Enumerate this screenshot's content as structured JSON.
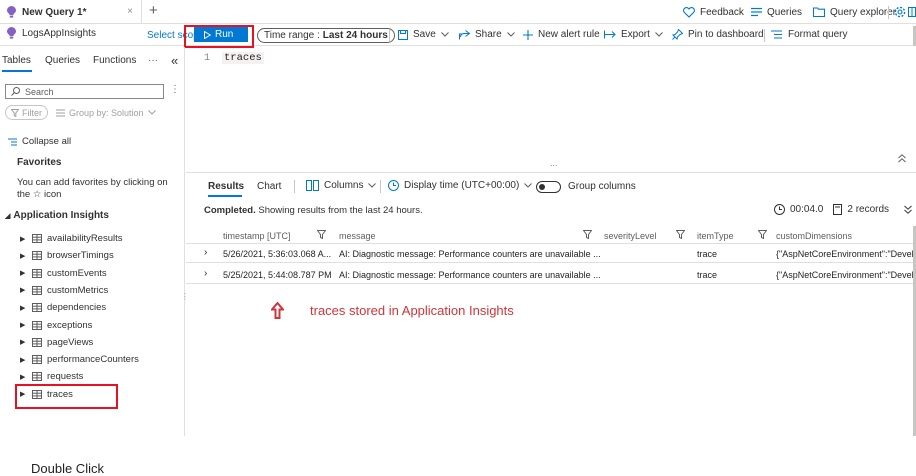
{
  "tabbar": {
    "tab_title": "New Query 1*",
    "close_glyph": "×",
    "new_tab_glyph": "+",
    "feedback": "Feedback",
    "queries": "Queries",
    "query_explorer": "Query explorer",
    "tab_icon": "lightbulb-icon"
  },
  "toolbar": {
    "scope_name": "LogsAppInsights",
    "select_scope": "Select scope",
    "run_label": "Run",
    "time_range_label": "Time range :",
    "time_range_value": "Last 24 hours",
    "save": "Save",
    "share": "Share",
    "new_alert": "New alert rule",
    "export": "Export",
    "pin": "Pin to dashboard",
    "format": "Format query"
  },
  "panel": {
    "tabs": [
      "Tables",
      "Queries",
      "Functions"
    ],
    "more": "···",
    "collapse_glyph": "«",
    "search_placeholder": "Search",
    "filter": "Filter",
    "group_by": "Group by: Solution",
    "collapse_all": "Collapse all",
    "favorites_title": "Favorites",
    "favorites_desc": "You can add favorites by clicking on the ☆ icon",
    "section": "Application Insights",
    "tables": [
      "availabilityResults",
      "browserTimings",
      "customEvents",
      "customMetrics",
      "dependencies",
      "exceptions",
      "pageViews",
      "performanceCounters",
      "requests",
      "traces"
    ],
    "double_click_note": "Double Click"
  },
  "editor": {
    "line_number": "1",
    "code": "traces",
    "splitter_dots": "...",
    "expand_glyph": "«"
  },
  "results": {
    "tabs": {
      "results": "Results",
      "chart": "Chart",
      "columns": "Columns",
      "display_time": "Display time (UTC+00:00)",
      "group_columns": "Group columns"
    },
    "status_bold": "Completed.",
    "status_text": "Showing results from the last 24 hours.",
    "duration": "00:04.0",
    "record_count": "2 records",
    "columns": [
      "timestamp [UTC]",
      "message",
      "severityLevel",
      "itemType",
      "customDimensions"
    ],
    "rows": [
      {
        "timestamp": "5/26/2021, 5:36:03.068 A...",
        "message": "AI: Diagnostic message: Performance counters are unavailable ...",
        "severity": "",
        "itemType": "trace",
        "dims": "{\"AspNetCoreEnvironment\":\"Devel"
      },
      {
        "timestamp": "5/25/2021, 5:44:08.787 PM",
        "message": "AI: Diagnostic message: Performance counters are unavailable ...",
        "severity": "",
        "itemType": "trace",
        "dims": "{\"AspNetCoreEnvironment\":\"Devel"
      }
    ],
    "annotation": "traces stored in Application Insights"
  },
  "colors": {
    "accent": "#0078d4",
    "highlight_box": "#e81123",
    "annotation": "#d13438",
    "app_icon": "#8661c5"
  }
}
